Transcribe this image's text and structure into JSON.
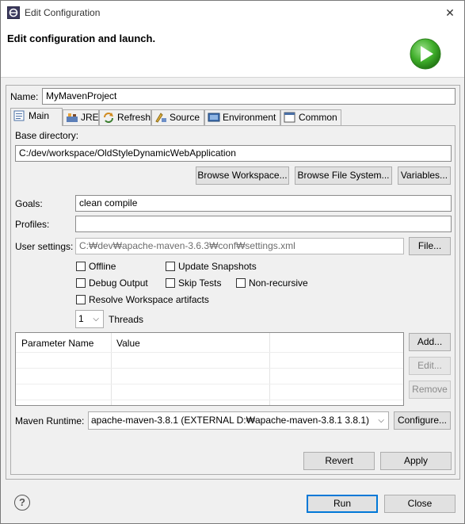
{
  "window": {
    "title": "Edit Configuration",
    "close_glyph": "✕"
  },
  "header": {
    "title": "Edit configuration and launch."
  },
  "name_field": {
    "label": "Name:",
    "value": "MyMavenProject"
  },
  "tabs": [
    {
      "label": "Main",
      "icon": "main-tab-icon"
    },
    {
      "label": "JRE",
      "icon": "jre-icon"
    },
    {
      "label": "Refresh",
      "icon": "refresh-icon"
    },
    {
      "label": "Source",
      "icon": "source-icon"
    },
    {
      "label": "Environment",
      "icon": "environment-icon"
    },
    {
      "label": "Common",
      "icon": "common-icon"
    }
  ],
  "main": {
    "base_directory_label": "Base directory:",
    "base_directory_value": "C:/dev/workspace/OldStyleDynamicWebApplication",
    "browse_workspace": "Browse Workspace...",
    "browse_filesystem": "Browse File System...",
    "variables": "Variables...",
    "goals_label": "Goals:",
    "goals_value": "clean compile",
    "profiles_label": "Profiles:",
    "profiles_value": "",
    "user_settings_label": "User settings:",
    "user_settings_value": "C:₩dev₩apache-maven-3.6.3₩conf₩settings.xml",
    "file_button": "File...",
    "checkboxes": {
      "offline": "Offline",
      "update_snapshots": "Update Snapshots",
      "debug_output": "Debug Output",
      "skip_tests": "Skip Tests",
      "non_recursive": "Non-recursive",
      "resolve_workspace": "Resolve Workspace artifacts"
    },
    "threads_value": "1",
    "threads_label": "Threads",
    "table": {
      "col_name": "Parameter Name",
      "col_value": "Value"
    },
    "add_button": "Add...",
    "edit_button": "Edit...",
    "remove_button": "Remove",
    "runtime_label": "Maven Runtime:",
    "runtime_value": "apache-maven-3.8.1 (EXTERNAL D:₩apache-maven-3.8.1 3.8.1)",
    "configure_button": "Configure..."
  },
  "revert_button": "Revert",
  "apply_button": "Apply",
  "run_button": "Run",
  "close_button": "Close",
  "help_glyph": "?",
  "colors": {
    "accent": "#0078d7",
    "run_green": "#3fae2a"
  }
}
